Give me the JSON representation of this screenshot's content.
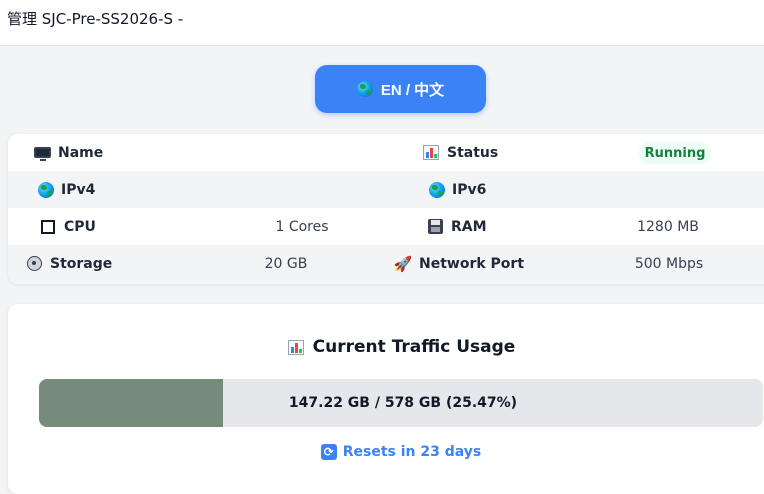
{
  "window": {
    "title": "管理 SJC-Pre-SS2026-S -"
  },
  "language_button": {
    "label": "EN / 中文",
    "icon": "globe-icon"
  },
  "info": {
    "name": {
      "label": "Name",
      "value": "",
      "icon": "monitor-icon"
    },
    "status": {
      "label": "Status",
      "value": "Running",
      "icon": "bar-chart-icon",
      "color": "#15803d"
    },
    "ipv4": {
      "label": "IPv4",
      "value": "",
      "icon": "globe-icon"
    },
    "ipv6": {
      "label": "IPv6",
      "value": "",
      "icon": "globe-icon"
    },
    "cpu": {
      "label": "CPU",
      "value": "1 Cores",
      "icon": "cpu-icon"
    },
    "ram": {
      "label": "RAM",
      "value": "1280 MB",
      "icon": "floppy-disk-icon"
    },
    "storage": {
      "label": "Storage",
      "value": "20 GB",
      "icon": "disk-icon"
    },
    "network_port": {
      "label": "Network Port",
      "value": "500 Mbps",
      "icon": "rocket-icon"
    }
  },
  "traffic": {
    "title": "Current Traffic Usage",
    "title_icon": "bar-chart-icon",
    "usage_text": "147.22 GB / 578 GB (25.47%)",
    "used_percent": 25.47,
    "bar_color": "#778b7b",
    "reset_text": "Resets in 23 days",
    "reset_icon": "reload-icon"
  },
  "colors": {
    "accent": "#3b82f6",
    "running": "#15803d"
  }
}
